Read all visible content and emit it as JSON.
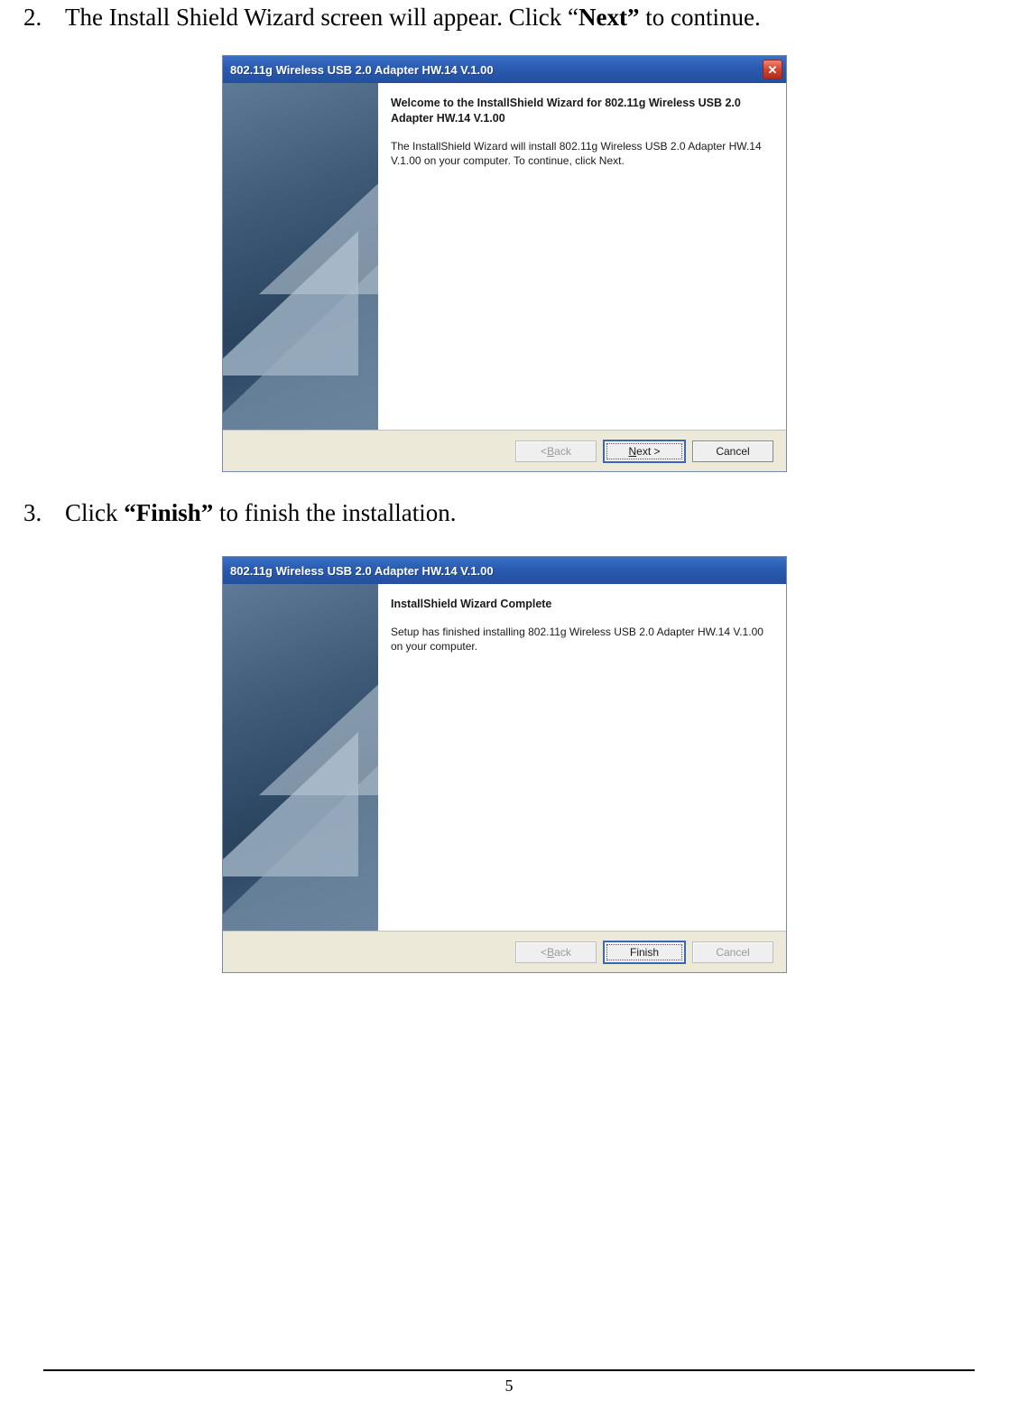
{
  "steps": {
    "step2": {
      "num": "2.",
      "pre": "The Install Shield Wizard screen will appear. Click “",
      "bold": "Next”",
      "post": " to continue."
    },
    "step3": {
      "num": "3.",
      "pre": "Click ",
      "bold": "“Finish”",
      "post": " to finish the installation."
    }
  },
  "dialog1": {
    "title": "802.11g Wireless USB 2.0 Adapter HW.14 V.1.00",
    "heading": "Welcome to the InstallShield Wizard for 802.11g Wireless USB 2.0 Adapter HW.14 V.1.00",
    "body": "The InstallShield Wizard will install 802.11g Wireless USB 2.0 Adapter HW.14 V.1.00 on your computer.  To continue, click Next.",
    "buttons": {
      "back_prefix": "< ",
      "back_u": "B",
      "back_suffix": "ack",
      "next_u": "N",
      "next_suffix": "ext >",
      "cancel": "Cancel"
    }
  },
  "dialog2": {
    "title": "802.11g Wireless USB 2.0 Adapter HW.14 V.1.00",
    "heading": "InstallShield Wizard Complete",
    "body": "Setup has finished installing 802.11g Wireless USB 2.0 Adapter HW.14 V.1.00 on your computer.",
    "buttons": {
      "back_prefix": "< ",
      "back_u": "B",
      "back_suffix": "ack",
      "finish": "Finish",
      "cancel": "Cancel"
    }
  },
  "page_number": "5"
}
